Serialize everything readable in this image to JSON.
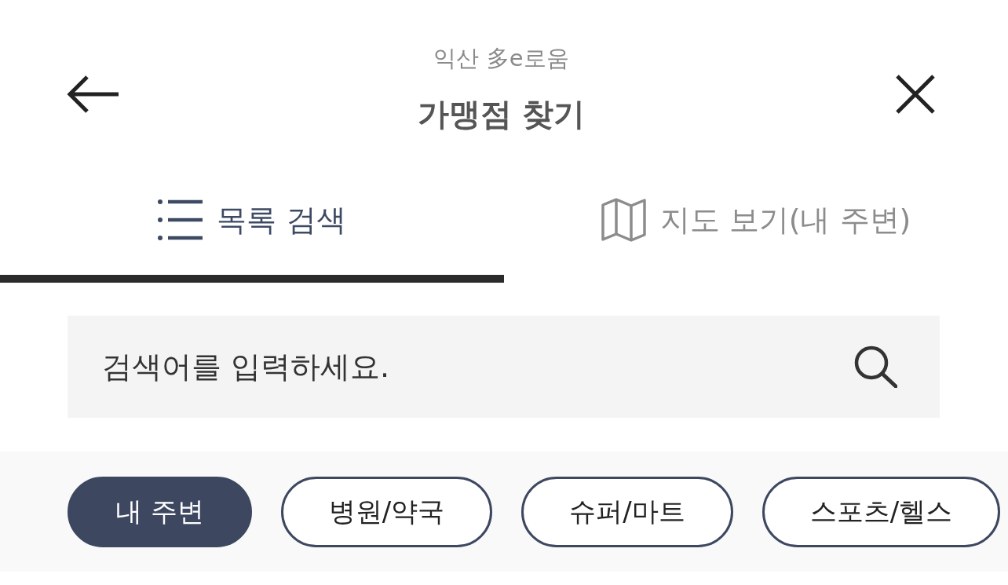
{
  "header": {
    "subtitle": "익산 多e로움",
    "title": "가맹점 찾기"
  },
  "tabs": [
    {
      "kind": "list",
      "label": "목록 검색",
      "selected": true
    },
    {
      "kind": "map",
      "label": "지도 보기(내 주변)",
      "selected": false
    }
  ],
  "search": {
    "placeholder": "검색어를 입력하세요."
  },
  "categories": [
    {
      "label": "내 주변",
      "selected": true
    },
    {
      "label": "병원/약국",
      "selected": false
    },
    {
      "label": "슈퍼/마트",
      "selected": false
    },
    {
      "label": "스포츠/헬스",
      "selected": false
    }
  ]
}
